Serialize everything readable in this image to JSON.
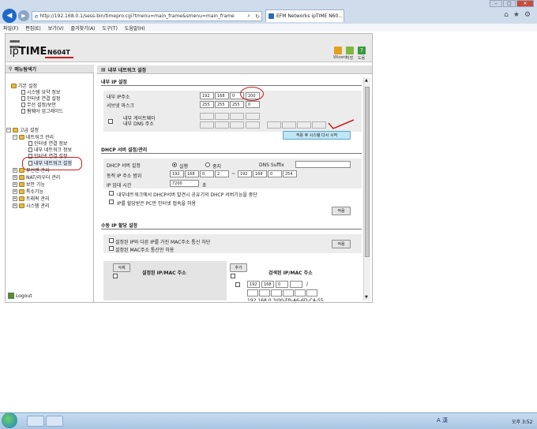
{
  "browser": {
    "url": "http://192.168.0.1/sess-bin/timepro.cgi?tmenu=main_frame&smenu=main_frame",
    "tab_title": "EFM Networks ipTIME N60...",
    "menu": [
      "파일(F)",
      "편집(E)",
      "보기(V)",
      "즐겨찾기(A)",
      "도구(T)",
      "도움말(H)"
    ]
  },
  "header": {
    "logo_prefix": "ip",
    "logo_bold": "TIME",
    "model": "N604T",
    "icons": [
      {
        "label": "Wizard",
        "color": "#e0a020"
      },
      {
        "label": "저장",
        "color": "#7fb83a"
      },
      {
        "label": "도움",
        "color": "#3a9a3a"
      }
    ]
  },
  "sidebar": {
    "title": "메뉴탐색기",
    "logout": "Logout",
    "basic": {
      "label": "기본 설정",
      "items": [
        "시스템 요약 정보",
        "인터넷 연결 설정",
        "무선 설정/보안",
        "펌웨어 업그레이드"
      ]
    },
    "advanced": {
      "label": "고급 설정",
      "network": "네트워크 관리",
      "network_items": [
        "인터넷 연결 정보",
        "내부 네트워크 정보",
        "인터넷 연결 설정",
        "내부 네트워크 설정"
      ],
      "other": [
        "무선랜 관리",
        "NAT/라우터 관리",
        "보안 기능",
        "특수기능",
        "트래픽 관리",
        "시스템 관리"
      ]
    }
  },
  "content": {
    "title": "내부 네트워크 설정",
    "ip_section": {
      "heading": "내부 IP 설정",
      "ip_label": "내부 IP주소",
      "ip": [
        "192",
        "168",
        "0",
        "200"
      ],
      "mask_label": "서브넷 마스크",
      "mask": [
        "255",
        "255",
        "255",
        "0"
      ],
      "gw_label": "내부 게이트웨이",
      "dns_label": "내부 DNS 주소",
      "apply_button": "적용 후 시스템 다시 시작"
    },
    "dhcp_section": {
      "heading": "DHCP 서버 설정/관리",
      "server_label": "DHCP 서버 설정",
      "run": "실행",
      "stop": "중지",
      "suffix_label": "DNS Suffix",
      "range_label": "동적 IP 주소 범위",
      "range_start": [
        "192",
        "168",
        "0",
        "2"
      ],
      "range_sep": "~",
      "range_end": [
        "192",
        "168",
        "0",
        "254"
      ],
      "lease_label": "IP 임대 시간",
      "lease": "7200",
      "lease_unit": "초",
      "opt1": "내부네트워크에서 DHCP서버 발견시 공유기의 DHCP 서버기능을 중단",
      "opt2": "IP를 할당받은 PC만 인터넷 접속을 허용",
      "apply_button": "적용"
    },
    "manual_section": {
      "heading": "수동 IP 할당 설정",
      "opt1": "설정된 IP와 다른 IP를 가진 MAC주소 통신 차단",
      "opt2": "설정된 MAC주소 통신만 허용",
      "apply_button": "적용",
      "delete_button": "삭제",
      "configured_header": "설정된 IP/MAC 주소",
      "add_button": "추가",
      "searched_header": "검색된 IP/MAC 주소",
      "new_ip": [
        "192",
        "168",
        "0",
        ""
      ],
      "slash": "/",
      "found_entry": "192.168.0.3/00-EB-A6-6D-CA-55"
    }
  },
  "taskbar": {
    "ime": "A 漢",
    "clock": "오후 3:52"
  }
}
